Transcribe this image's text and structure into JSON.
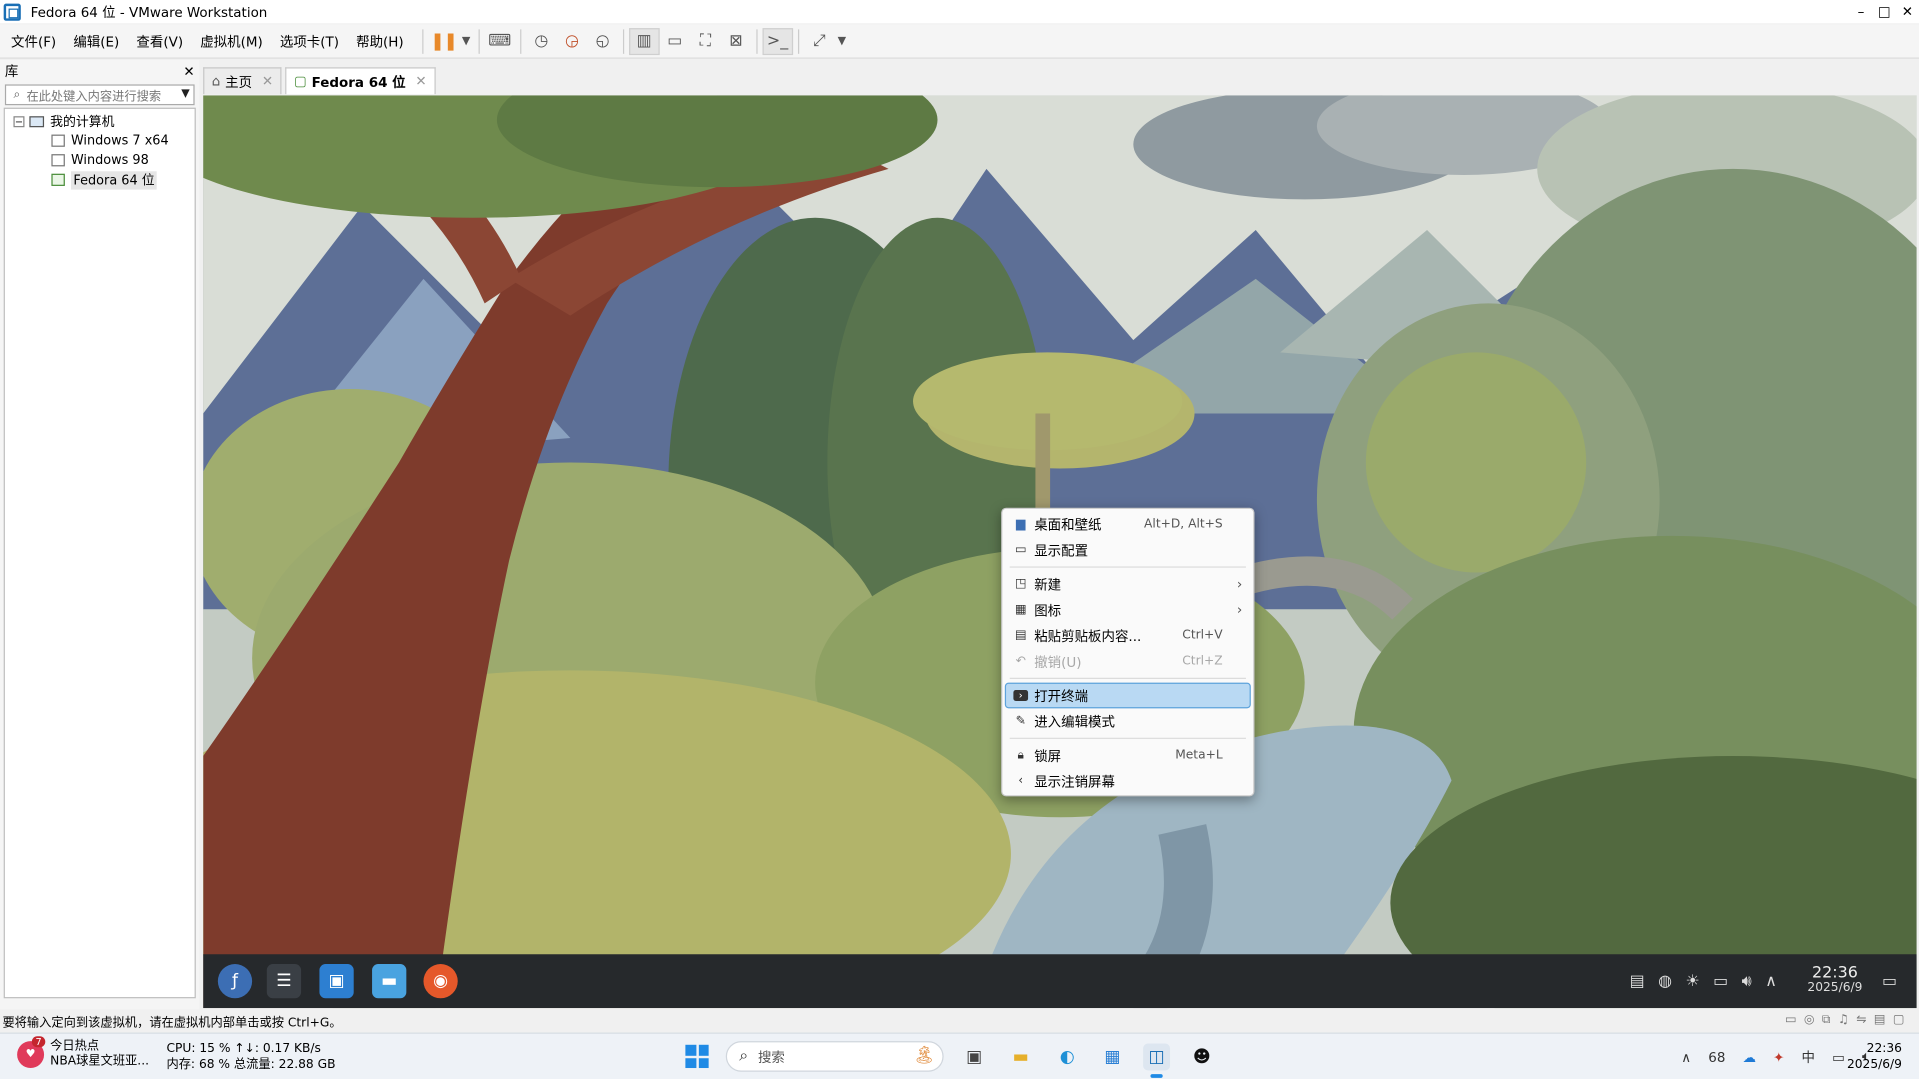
{
  "window": {
    "title": "Fedora 64 位 - VMware Workstation",
    "controls": [
      "–",
      "□",
      "✕"
    ]
  },
  "menu": {
    "items": [
      "文件(F)",
      "编辑(E)",
      "查看(V)",
      "虚拟机(M)",
      "选项卡(T)",
      "帮助(H)"
    ]
  },
  "library": {
    "title": "库",
    "close": "✕",
    "search_placeholder": "在此处键入内容进行搜索",
    "root": "我的计算机",
    "expand": "−",
    "vms": [
      "Windows 7 x64",
      "Windows 98",
      "Fedora 64 位"
    ]
  },
  "tabs": [
    {
      "label": "主页",
      "close": "✕"
    },
    {
      "label": "Fedora 64 位",
      "close": "✕"
    }
  ],
  "context_menu": {
    "items": [
      {
        "label": "桌面和壁纸",
        "shortcut": "Alt+D, Alt+S"
      },
      {
        "label": "显示配置",
        "shortcut": ""
      },
      {
        "label": "新建",
        "arrow": "›"
      },
      {
        "label": "图标",
        "arrow": "›"
      },
      {
        "label": "粘贴剪贴板内容...",
        "shortcut": "Ctrl+V"
      },
      {
        "label": "撤销(U)",
        "shortcut": "Ctrl+Z"
      },
      {
        "label": "打开终端",
        "shortcut": ""
      },
      {
        "label": "进入编辑模式",
        "shortcut": ""
      },
      {
        "label": "锁屏",
        "shortcut": "Meta+L"
      },
      {
        "label": "显示注销屏幕",
        "shortcut": ""
      }
    ]
  },
  "fedora_panel": {
    "time": "22:36",
    "date": "2025/6/9"
  },
  "status_bar": {
    "text": "要将输入定向到该虚拟机，请在虚拟机内部单击或按 Ctrl+G。"
  },
  "taskbar": {
    "news_title": "今日热点",
    "news_sub": "NBA球星文班亚...",
    "news_badge": "7",
    "cpu_line": "CPU: 15 %  ↑↓: 0.17 KB/s",
    "mem_line": "内存: 68 %  总流量: 22.88 GB",
    "search_placeholder": "搜索",
    "tray_count": "68",
    "ime": "中",
    "time": "22:36",
    "date": "2025/6/9"
  },
  "colors": {
    "accent": "#1f8ae5",
    "pause": "#e8892a",
    "highlight": "#b9d9f3"
  }
}
